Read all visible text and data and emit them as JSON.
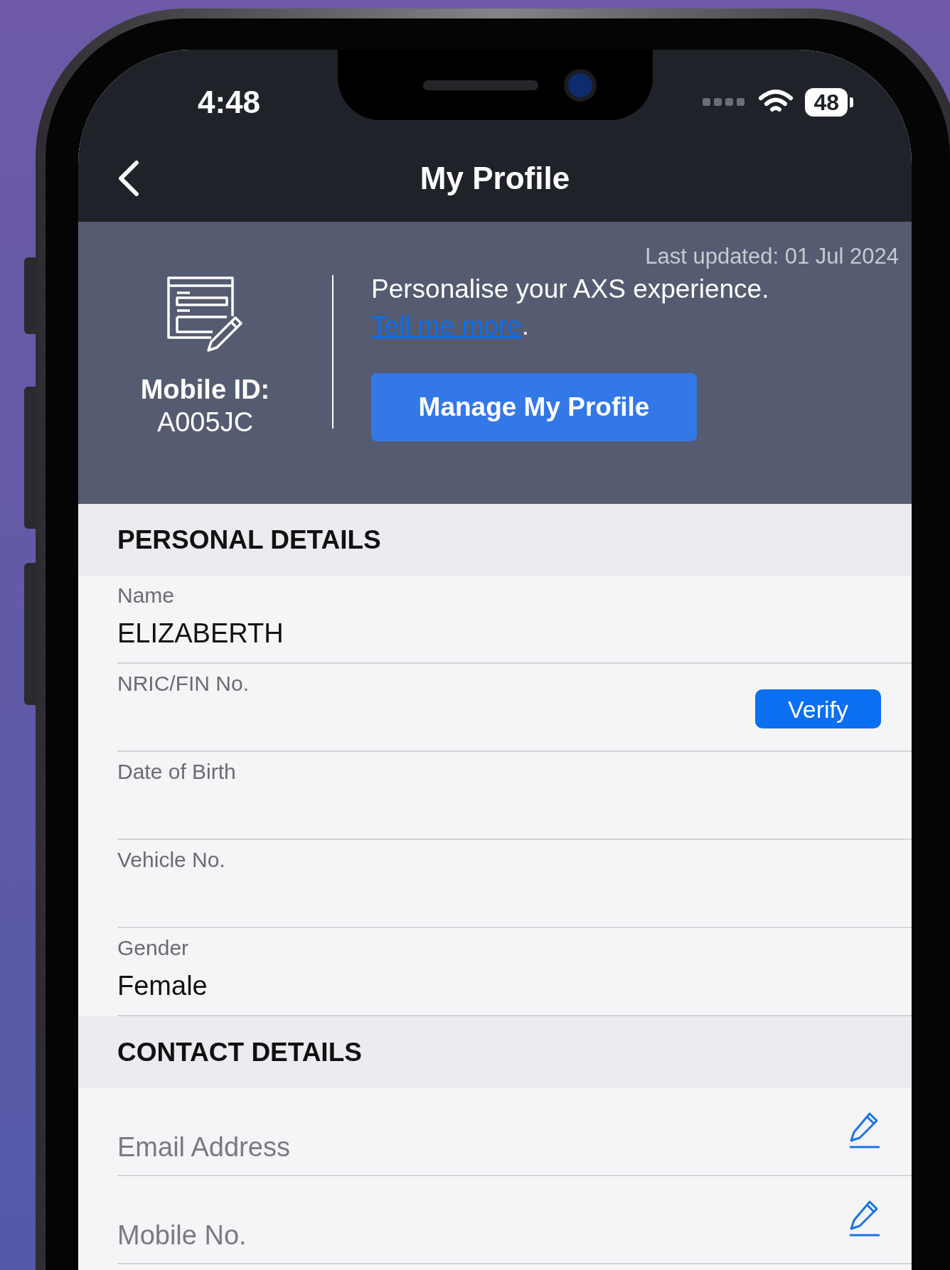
{
  "status_bar": {
    "time": "4:48",
    "battery": "48"
  },
  "nav": {
    "title": "My Profile"
  },
  "profile_card": {
    "last_updated": "Last updated: 01 Jul 2024",
    "mobile_id_label": "Mobile ID:",
    "mobile_id": "A005JC",
    "message": "Personalise your AXS experience.",
    "link": "Tell me more",
    "link_suffix": ".",
    "button": "Manage My Profile"
  },
  "sections": [
    {
      "title": "PERSONAL DETAILS",
      "fields": [
        {
          "kind": "value",
          "label": "Name",
          "value": "ELIZABERTH"
        },
        {
          "kind": "verify",
          "label": "NRIC/FIN No.",
          "button": "Verify"
        },
        {
          "kind": "value",
          "label": "Date of Birth"
        },
        {
          "kind": "value",
          "label": "Vehicle No."
        },
        {
          "kind": "value",
          "label": "Gender",
          "value": "Female"
        }
      ]
    },
    {
      "title": "CONTACT DETAILS",
      "fields": [
        {
          "kind": "editable",
          "placeholder": "Email Address"
        },
        {
          "kind": "editable",
          "placeholder": "Mobile No."
        }
      ]
    }
  ]
}
